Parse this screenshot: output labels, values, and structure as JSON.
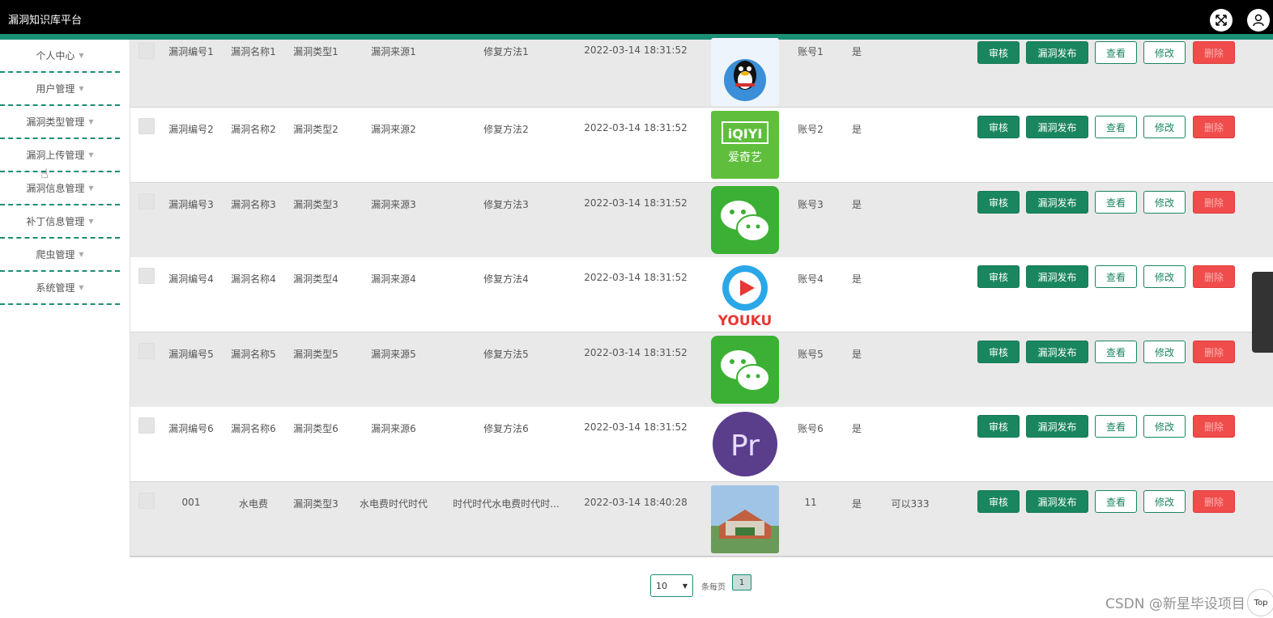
{
  "app": {
    "title": "漏洞知识库平台"
  },
  "sidebar": {
    "items": [
      {
        "label": "个人中心"
      },
      {
        "label": "用户管理"
      },
      {
        "label": "漏洞类型管理"
      },
      {
        "label": "漏洞上传管理"
      },
      {
        "label": "漏洞信息管理"
      },
      {
        "label": "补丁信息管理"
      },
      {
        "label": "爬虫管理"
      },
      {
        "label": "系统管理"
      }
    ],
    "caret": "▼"
  },
  "actions": {
    "review": "审核",
    "publish": "漏洞发布",
    "view": "查看",
    "edit": "修改",
    "delete": "删除"
  },
  "rows": [
    {
      "no": "漏洞编号1",
      "name": "漏洞名称1",
      "type": "漏洞类型1",
      "source": "漏洞来源1",
      "fix": "修复方法1",
      "time": "2022-03-14 18:31:52",
      "image": "qq-penguin-image",
      "account": "账号1",
      "flag": "是",
      "remark": ""
    },
    {
      "no": "漏洞编号2",
      "name": "漏洞名称2",
      "type": "漏洞类型2",
      "source": "漏洞来源2",
      "fix": "修复方法2",
      "time": "2022-03-14 18:31:52",
      "image": "iqiyi-logo-image",
      "image_text": "iQIYI",
      "image_subtext": "爱奇艺",
      "account": "账号2",
      "flag": "是",
      "remark": ""
    },
    {
      "no": "漏洞编号3",
      "name": "漏洞名称3",
      "type": "漏洞类型3",
      "source": "漏洞来源3",
      "fix": "修复方法3",
      "time": "2022-03-14 18:31:52",
      "image": "wechat-logo-image",
      "account": "账号3",
      "flag": "是",
      "remark": ""
    },
    {
      "no": "漏洞编号4",
      "name": "漏洞名称4",
      "type": "漏洞类型4",
      "source": "漏洞来源4",
      "fix": "修复方法4",
      "time": "2022-03-14 18:31:52",
      "image": "youku-logo-image",
      "image_text": "YOUKU",
      "account": "账号4",
      "flag": "是",
      "remark": ""
    },
    {
      "no": "漏洞编号5",
      "name": "漏洞名称5",
      "type": "漏洞类型5",
      "source": "漏洞来源5",
      "fix": "修复方法5",
      "time": "2022-03-14 18:31:52",
      "image": "wechat-logo-image",
      "account": "账号5",
      "flag": "是",
      "remark": ""
    },
    {
      "no": "漏洞编号6",
      "name": "漏洞名称6",
      "type": "漏洞类型6",
      "source": "漏洞来源6",
      "fix": "修复方法6",
      "time": "2022-03-14 18:31:52",
      "image": "premiere-logo-image",
      "image_text": "Pr",
      "account": "账号6",
      "flag": "是",
      "remark": ""
    },
    {
      "no": "001",
      "name": "水电费",
      "type": "漏洞类型3",
      "source": "水电费时代时代",
      "fix": "时代时代水电费时代时...",
      "time": "2022-03-14 18:40:28",
      "image": "building-photo-image",
      "account": "11",
      "flag": "是",
      "remark": "可以333"
    }
  ],
  "pagination": {
    "page_size": "10",
    "per_page_label": "条每页",
    "current_page": "1"
  },
  "watermark": "CSDN @新星毕设项目",
  "corner_label": "Top",
  "colors": {
    "teal": "#1b8f74",
    "button_green": "#19865f",
    "delete_red": "#f04c4c"
  }
}
